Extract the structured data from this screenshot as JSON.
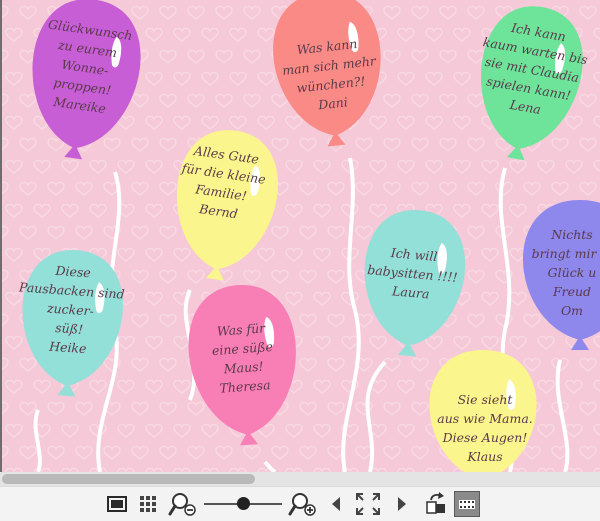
{
  "balloons": [
    {
      "id": "balloon-mareike",
      "color": "#c75ed6",
      "lines": [
        "Glückwunsch",
        "zu eurem",
        "Wonne-",
        "proppen!",
        "Mareike"
      ]
    },
    {
      "id": "balloon-dani",
      "color": "#f98a86",
      "lines": [
        "Was kann",
        "man sich mehr",
        "wünchen?!",
        "Dani"
      ]
    },
    {
      "id": "balloon-lena",
      "color": "#6ee39a",
      "lines": [
        "Ich kann",
        "kaum warten bis",
        "sie mit Claudia",
        "spielen kann!",
        "Lena"
      ]
    },
    {
      "id": "balloon-bernd",
      "color": "#fbf58e",
      "lines": [
        "Alles Gute",
        "für die kleine",
        "Familie!",
        "Bernd"
      ]
    },
    {
      "id": "balloon-laura",
      "color": "#93e0d8",
      "lines": [
        "Ich will",
        "babysitten !!!!",
        "Laura"
      ]
    },
    {
      "id": "balloon-heike",
      "color": "#93e0d8",
      "lines": [
        "Diese",
        "Pausbacken sind",
        "zucker-",
        "süß!",
        "Heike"
      ]
    },
    {
      "id": "balloon-theresa",
      "color": "#f87eb6",
      "lines": [
        "Was für",
        "eine süße",
        "Maus!",
        "Theresa"
      ]
    },
    {
      "id": "balloon-partial",
      "color": "#8f88ec",
      "lines": [
        "Nichts",
        "bringt mir m",
        "Glück u",
        "Freud",
        "Om"
      ]
    },
    {
      "id": "balloon-klaus",
      "color": "#fbf58e",
      "lines": [
        "Sie sieht",
        "aus wie Mama.",
        "Diese Augen!",
        "Klaus"
      ]
    }
  ],
  "colors": {
    "background": "#f5c9d7",
    "heart": "#f8d8e2",
    "string": "#ffffff",
    "text": "#5a3a4a"
  },
  "toolbar": {
    "icons": [
      "single-page-view-icon",
      "grid-view-icon",
      "zoom-out-icon",
      "zoom-slider",
      "zoom-in-icon",
      "previous-page-icon",
      "fullscreen-icon",
      "next-page-icon",
      "rotate-icon",
      "slideshow-icon"
    ],
    "zoom_level": 0.5
  },
  "scrollbar": {
    "position": 0.0,
    "visible_fraction": 0.42
  }
}
